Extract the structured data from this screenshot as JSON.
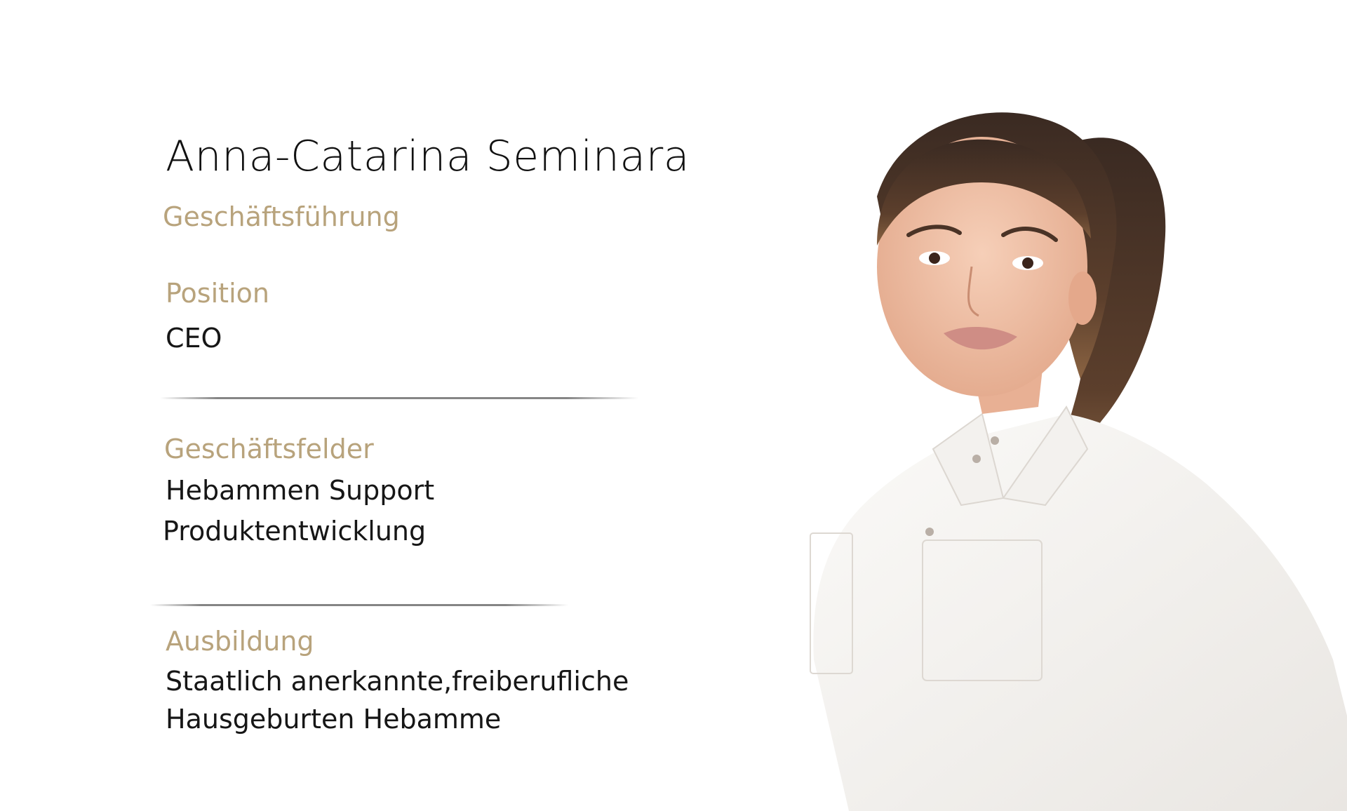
{
  "profile": {
    "name": "Anna-Catarina Seminara",
    "role": "Geschäftsführung"
  },
  "sections": [
    {
      "label": "Position",
      "lines": [
        "CEO"
      ]
    },
    {
      "label": "Geschäftsfelder",
      "lines": [
        "Hebammen Support",
        "Produktentwicklung"
      ]
    },
    {
      "label": "Ausbildung",
      "lines": [
        "Staatlich anerkannte,freiberufliche",
        "Hausgeburten Hebamme"
      ]
    }
  ],
  "colors": {
    "accent": "#b8a37c",
    "text": "#161616",
    "background": "#ffffff"
  }
}
